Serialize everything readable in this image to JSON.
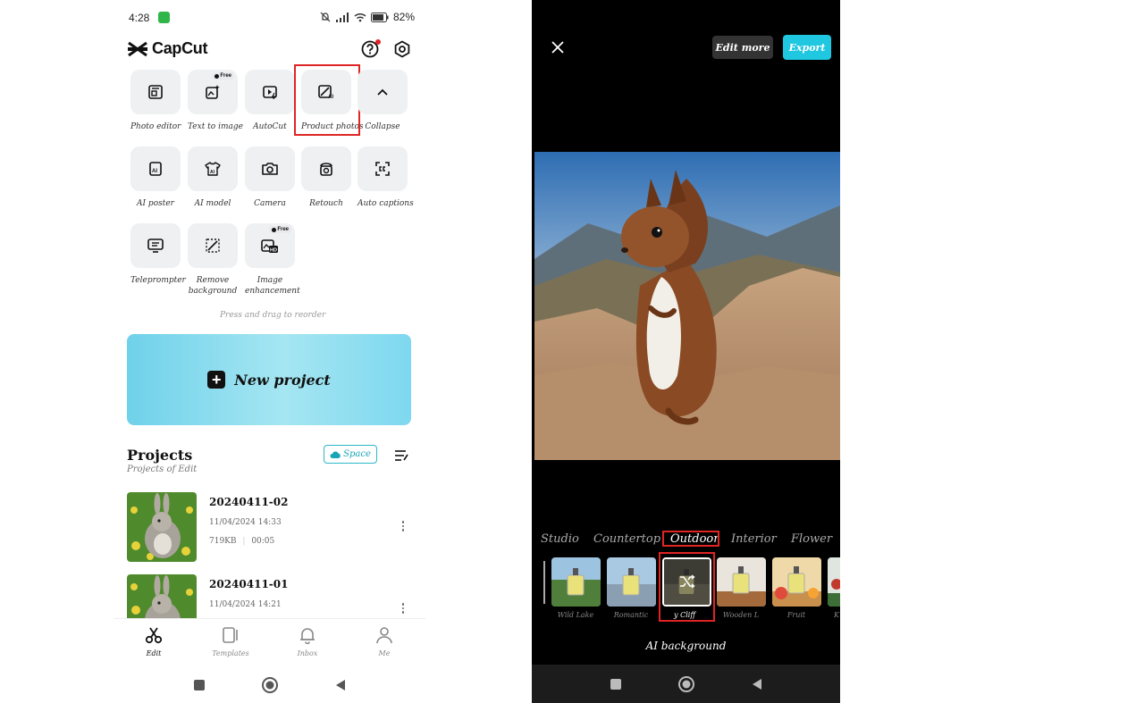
{
  "left_screen": {
    "status": {
      "time": "4:28",
      "battery": "82%"
    },
    "app_name": "CapCut",
    "tools": [
      {
        "label": "Photo editor",
        "icon": "photo-editor-icon",
        "badge": ""
      },
      {
        "label": "Text to image",
        "icon": "text-to-image-icon",
        "badge": "Free"
      },
      {
        "label": "AutoCut",
        "icon": "autocut-icon",
        "badge": ""
      },
      {
        "label": "Product photos",
        "icon": "product-photos-icon",
        "badge": "",
        "highlighted": true
      },
      {
        "label": "Collapse",
        "icon": "chevron-up-icon",
        "badge": ""
      },
      {
        "label": "AI poster",
        "icon": "ai-poster-icon",
        "badge": ""
      },
      {
        "label": "AI model",
        "icon": "ai-model-icon",
        "badge": ""
      },
      {
        "label": "Camera",
        "icon": "camera-icon",
        "badge": ""
      },
      {
        "label": "Retouch",
        "icon": "retouch-icon",
        "badge": ""
      },
      {
        "label": "Auto captions",
        "icon": "auto-captions-icon",
        "badge": ""
      },
      {
        "label": "Teleprompter",
        "icon": "teleprompter-icon",
        "badge": ""
      },
      {
        "label": "Remove background",
        "icon": "remove-background-icon",
        "badge": ""
      },
      {
        "label": "Image enhancement",
        "icon": "image-enhancement-icon",
        "badge": "Free"
      }
    ],
    "reorder_hint": "Press and drag to reorder",
    "new_project_label": "New project",
    "projects": {
      "title": "Projects",
      "subtitle": "Projects of Edit",
      "space_label": "Space",
      "items": [
        {
          "name": "20240411-02",
          "date": "11/04/2024 14:33",
          "size": "719KB",
          "duration": "00:05"
        },
        {
          "name": "20240411-01",
          "date": "11/04/2024 14:21",
          "size": "",
          "duration": ""
        }
      ]
    },
    "nav": [
      {
        "label": "Edit",
        "icon": "scissors-icon",
        "active": true
      },
      {
        "label": "Templates",
        "icon": "templates-icon",
        "active": false
      },
      {
        "label": "Inbox",
        "icon": "bell-icon",
        "active": false
      },
      {
        "label": "Me",
        "icon": "person-icon",
        "active": false
      }
    ]
  },
  "right_screen": {
    "edit_more_label": "Edit more",
    "export_label": "Export",
    "categories": [
      {
        "label": "Studio",
        "selected": false
      },
      {
        "label": "Countertop",
        "selected": false
      },
      {
        "label": "Outdoor",
        "selected": true
      },
      {
        "label": "Interior",
        "selected": false
      },
      {
        "label": "Flower",
        "selected": false
      }
    ],
    "backgrounds": [
      {
        "label": "Wild Lake",
        "selected": false
      },
      {
        "label": "Romantic",
        "selected": false
      },
      {
        "label": "y Cliff",
        "selected": true
      },
      {
        "label": "Wooden L",
        "selected": false
      },
      {
        "label": "Fruit",
        "selected": false
      },
      {
        "label": "K",
        "selected": false
      }
    ],
    "footer_label": "AI background"
  },
  "colors": {
    "accent_cyan": "#1fc7e0",
    "highlight_red": "#e02424",
    "dark_button": "#333333"
  }
}
